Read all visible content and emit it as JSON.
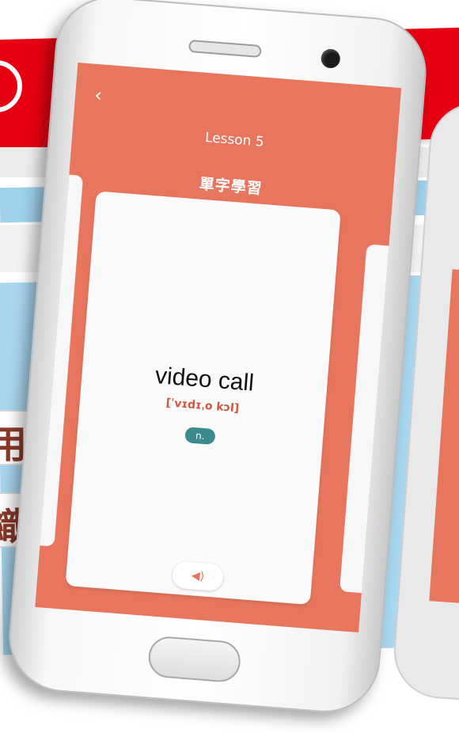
{
  "background": {
    "colors": {
      "red": "#e60012",
      "blue": "#a9d7f0",
      "char_color": "#8a3a2a"
    },
    "char_1": "用",
    "char_2": "織"
  },
  "app": {
    "back_icon": "chevron-left-icon",
    "lesson_title": "Lesson 5",
    "section_title": "單字學習",
    "accent_color": "#e8765e"
  },
  "flashcard": {
    "word": "video call",
    "phonetic": "[ˈvɪdɪˌo kɔl]",
    "part_of_speech": "n."
  },
  "controls": {
    "audio_icon": "speaker-icon",
    "audio_symbol": "◀)"
  }
}
